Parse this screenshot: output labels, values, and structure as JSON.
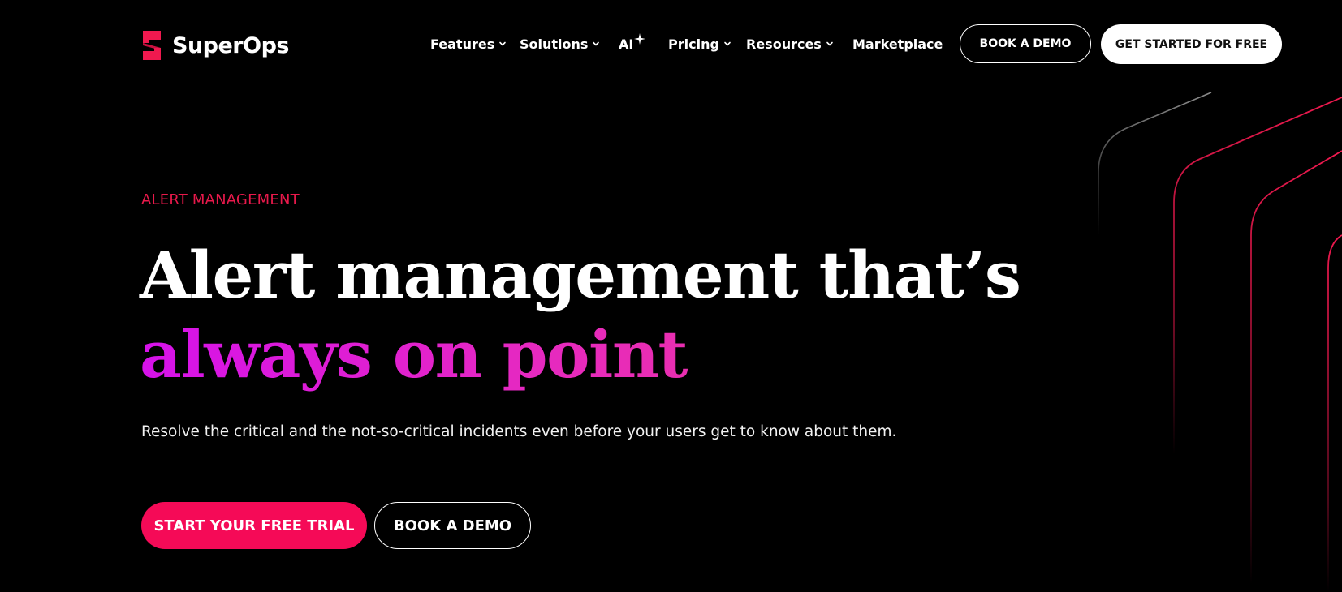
{
  "brand": {
    "name": "SuperOps",
    "accent_color": "#f50a57",
    "logo_icon": "superops-logo-icon"
  },
  "nav": {
    "items": [
      {
        "label": "Features",
        "has_dropdown": true
      },
      {
        "label": "Solutions",
        "has_dropdown": true
      },
      {
        "label": "AI",
        "icon": "sparkle-icon"
      },
      {
        "label": "Pricing",
        "has_dropdown": true
      },
      {
        "label": "Resources",
        "has_dropdown": true
      },
      {
        "label": "Marketplace"
      }
    ],
    "demo_button": "BOOK A DEMO",
    "start_button": "GET STARTED FOR FREE"
  },
  "hero": {
    "eyebrow": "ALERT MANAGEMENT",
    "headline_line1": "Alert management that’s",
    "headline_line2": "always on point",
    "subtitle": "Resolve the critical and the not-so-critical incidents even before your users get to know about them.",
    "primary_cta": "START YOUR FREE TRIAL",
    "secondary_cta": "BOOK A DEMO",
    "eyebrow_color": "#e8194b",
    "gradient_colors": [
      "#d612ea",
      "#f0398e"
    ]
  }
}
